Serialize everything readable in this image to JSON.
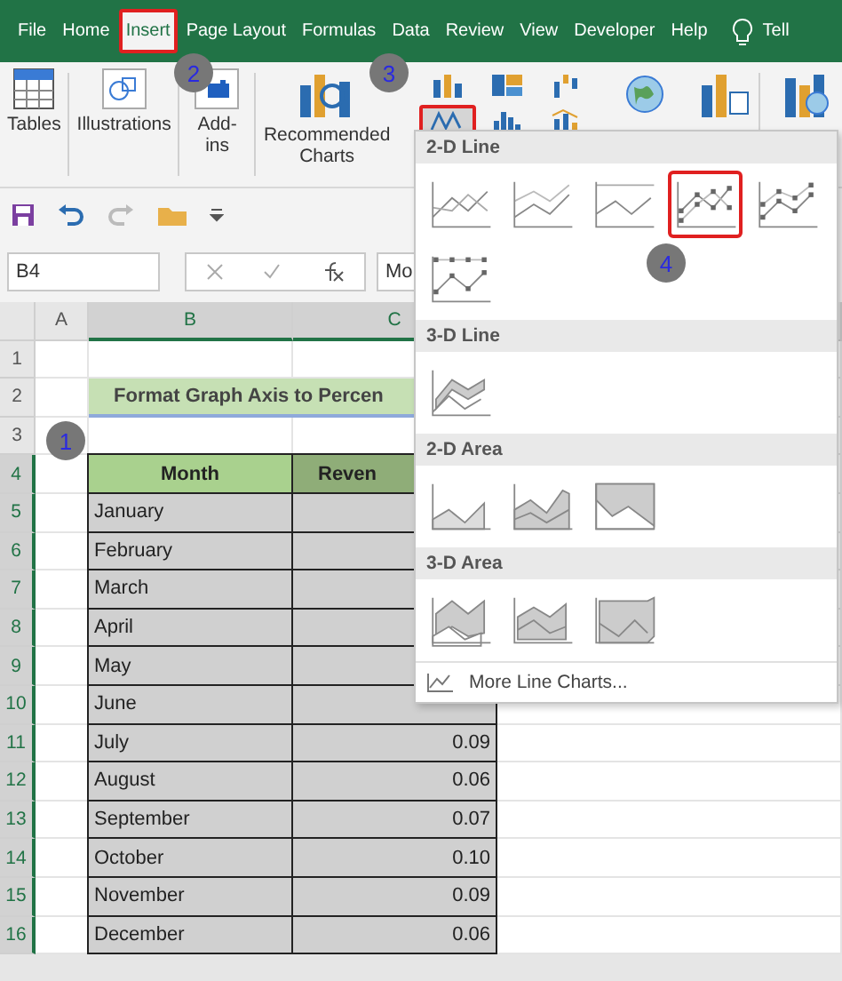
{
  "tabs": [
    {
      "label": "File",
      "selected": false
    },
    {
      "label": "Home",
      "selected": false
    },
    {
      "label": "Insert",
      "selected": true
    },
    {
      "label": "Page Layout",
      "selected": false
    },
    {
      "label": "Formulas",
      "selected": false
    },
    {
      "label": "Data",
      "selected": false
    },
    {
      "label": "Review",
      "selected": false
    },
    {
      "label": "View",
      "selected": false
    },
    {
      "label": "Developer",
      "selected": false
    },
    {
      "label": "Help",
      "selected": false
    }
  ],
  "tell": "Tell",
  "ribbon": {
    "groups": [
      {
        "kind": "tables",
        "label": "Tables"
      },
      {
        "kind": "illustrations",
        "label": "Illustrations"
      },
      {
        "kind": "addins",
        "label": "Add-ins"
      },
      {
        "kind": "recommended",
        "label": "Recommended Charts"
      }
    ],
    "chart_buttons": [
      {
        "kind": "column",
        "selected": false
      },
      {
        "kind": "line",
        "selected": true
      },
      {
        "kind": "hierarchy",
        "selected": false
      },
      {
        "kind": "statistic",
        "selected": false
      },
      {
        "kind": "waterfall",
        "selected": false
      },
      {
        "kind": "combo",
        "selected": false
      }
    ]
  },
  "formula_bar": {
    "name_box": "B4",
    "value": "Mo"
  },
  "columns": [
    {
      "label": "A",
      "selected": false
    },
    {
      "label": "B",
      "selected": true
    },
    {
      "label": "C",
      "selected": true
    }
  ],
  "rows": [
    {
      "number": "1",
      "selected": false
    },
    {
      "number": "2",
      "selected": false
    },
    {
      "number": "3",
      "selected": false
    },
    {
      "number": "4",
      "selected": true
    },
    {
      "number": "5",
      "selected": true
    },
    {
      "number": "6",
      "selected": true
    },
    {
      "number": "7",
      "selected": true
    },
    {
      "number": "8",
      "selected": true
    },
    {
      "number": "9",
      "selected": true
    },
    {
      "number": "10",
      "selected": true
    },
    {
      "number": "11",
      "selected": true
    },
    {
      "number": "12",
      "selected": true
    },
    {
      "number": "13",
      "selected": true
    },
    {
      "number": "14",
      "selected": true
    },
    {
      "number": "15",
      "selected": true
    },
    {
      "number": "16",
      "selected": true
    }
  ],
  "sheet": {
    "title": "Format Graph Axis to Percen",
    "headers": [
      "Month",
      "Reven"
    ],
    "data": [
      {
        "month": "January"
      },
      {
        "month": "February"
      },
      {
        "month": "March"
      },
      {
        "month": "April"
      },
      {
        "month": "May"
      },
      {
        "month": "June"
      },
      {
        "month": "July",
        "revenue": "0.09"
      },
      {
        "month": "August",
        "revenue": "0.06"
      },
      {
        "month": "September",
        "revenue": "0.07"
      },
      {
        "month": "October",
        "revenue": "0.10"
      },
      {
        "month": "November",
        "revenue": "0.09"
      },
      {
        "month": "December",
        "revenue": "0.06"
      }
    ]
  },
  "dropdown": {
    "sections": [
      {
        "title": "2-D Line",
        "items": [
          {
            "kind": "line",
            "selected": false
          },
          {
            "kind": "stackedline",
            "selected": false
          },
          {
            "kind": "percentline",
            "selected": false
          },
          {
            "kind": "linemarkers",
            "selected": true
          },
          {
            "kind": "stackedmarkers",
            "selected": false
          },
          {
            "kind": "percentmarkers",
            "selected": false
          }
        ]
      },
      {
        "title": "3-D Line",
        "items": [
          {
            "kind": "line3d",
            "selected": false
          }
        ]
      },
      {
        "title": "2-D Area",
        "items": [
          {
            "kind": "area",
            "selected": false
          },
          {
            "kind": "stackedarea",
            "selected": false
          },
          {
            "kind": "percentarea",
            "selected": false
          }
        ]
      },
      {
        "title": "3-D Area",
        "items": [
          {
            "kind": "area3d",
            "selected": false
          },
          {
            "kind": "stackedarea3d",
            "selected": false
          },
          {
            "kind": "percentarea3d",
            "selected": false
          }
        ]
      }
    ],
    "footer": "More Line Charts..."
  },
  "steps": [
    "1",
    "2",
    "3",
    "4"
  ]
}
